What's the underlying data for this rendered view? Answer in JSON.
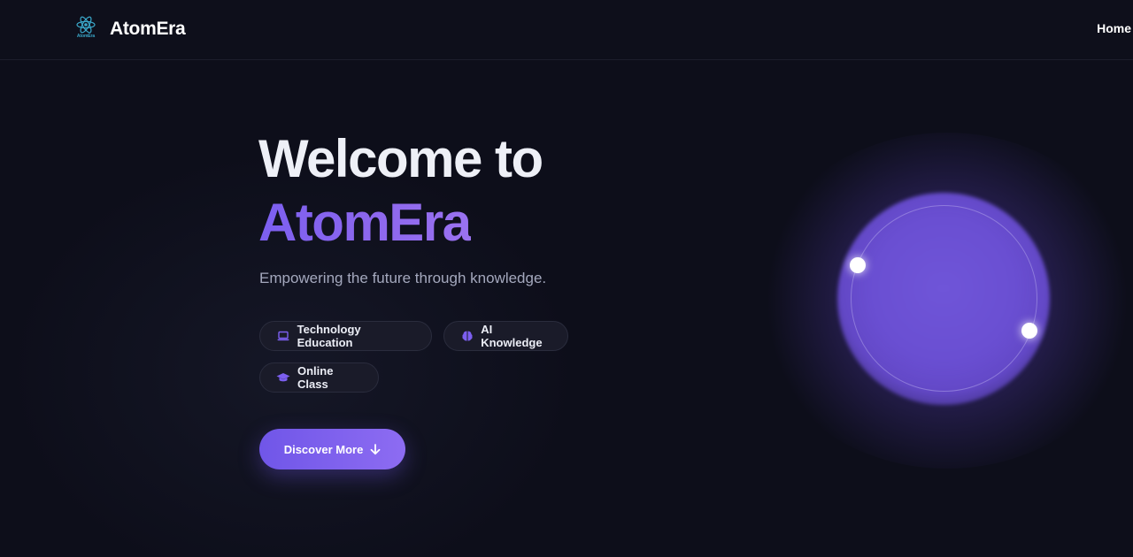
{
  "header": {
    "logo_text": "AtomEra",
    "brand": "AtomEra",
    "nav": {
      "home": "Home"
    }
  },
  "hero": {
    "title_line1": "Welcome to",
    "title_line2": "AtomEra",
    "tagline": "Empowering the future through knowledge.",
    "tags": [
      {
        "label": "Technology Education",
        "icon": "laptop-icon"
      },
      {
        "label": "AI Knowledge",
        "icon": "brain-icon"
      },
      {
        "label": "Online Class",
        "icon": "graduation-cap-icon"
      }
    ],
    "cta_label": "Discover More",
    "cta_icon": "arrow-down-icon"
  },
  "colors": {
    "background": "#0d0e1a",
    "accent": "#7c5ff0",
    "tag_background": "#1a1b29",
    "orb": "#6f55d8"
  }
}
